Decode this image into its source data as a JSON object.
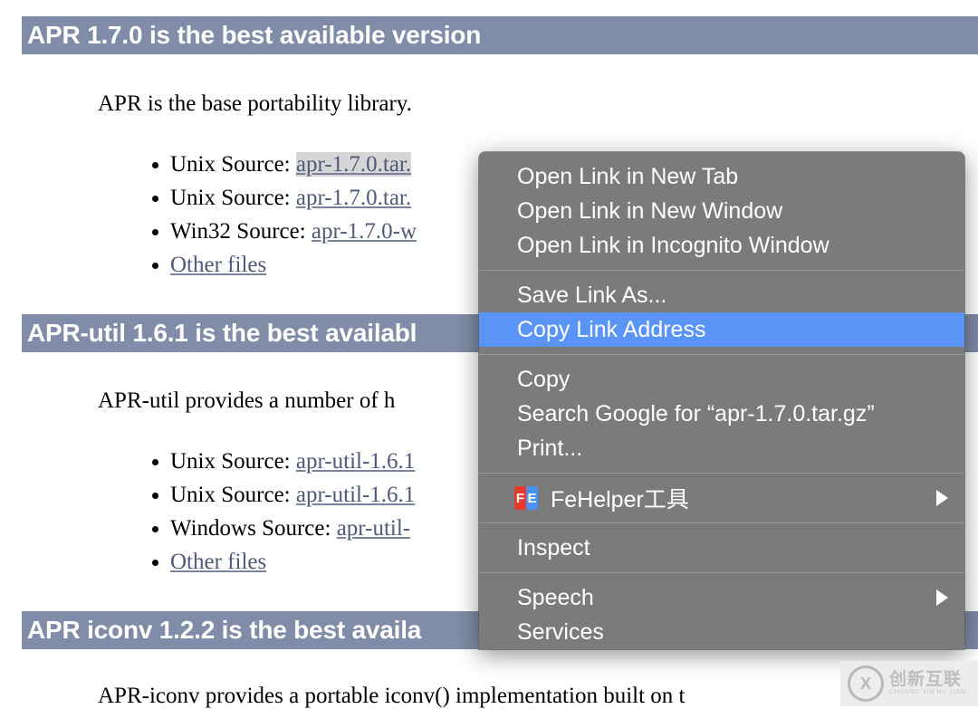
{
  "page": {
    "sections": [
      {
        "heading": "APR 1.7.0 is the best available version",
        "paragraph": "APR is the base portability library.",
        "items": [
          {
            "prefix": "Unix Source: ",
            "link": "apr-1.7.0.tar.",
            "selected": true
          },
          {
            "prefix": "Unix Source: ",
            "link": "apr-1.7.0.tar.",
            "selected": false
          },
          {
            "prefix": "Win32 Source: ",
            "link": "apr-1.7.0-w",
            "selected": false
          },
          {
            "prefix": "",
            "link": "Other files",
            "selected": false
          }
        ]
      },
      {
        "heading": "APR-util 1.6.1 is the best availabl",
        "paragraph": "APR-util provides a number of h",
        "items": [
          {
            "prefix": "Unix Source: ",
            "link": "apr-util-1.6.1",
            "selected": false
          },
          {
            "prefix": "Unix Source: ",
            "link": "apr-util-1.6.1",
            "selected": false
          },
          {
            "prefix": "Windows Source: ",
            "link": "apr-util-",
            "selected": false
          },
          {
            "prefix": "",
            "link": "Other files",
            "selected": false
          }
        ]
      },
      {
        "heading": "APR iconv 1.2.2 is the best availa",
        "paragraph": "APR-iconv provides a portable iconv() implementation built on t",
        "items": []
      }
    ],
    "colors": {
      "heading_band": "#808ca8",
      "link": "#50597a",
      "selected_link_bg": "#d6d6d6"
    }
  },
  "context_menu": {
    "groups": [
      {
        "items": [
          {
            "label": "Open Link in New Tab",
            "highlight": false,
            "arrow": false,
            "icon": ""
          },
          {
            "label": "Open Link in New Window",
            "highlight": false,
            "arrow": false,
            "icon": ""
          },
          {
            "label": "Open Link in Incognito Window",
            "highlight": false,
            "arrow": false,
            "icon": ""
          }
        ]
      },
      {
        "items": [
          {
            "label": "Save Link As...",
            "highlight": false,
            "arrow": false,
            "icon": ""
          },
          {
            "label": "Copy Link Address",
            "highlight": true,
            "arrow": false,
            "icon": ""
          }
        ]
      },
      {
        "items": [
          {
            "label": "Copy",
            "highlight": false,
            "arrow": false,
            "icon": ""
          },
          {
            "label": "Search Google for “apr-1.7.0.tar.gz”",
            "highlight": false,
            "arrow": false,
            "icon": ""
          },
          {
            "label": "Print...",
            "highlight": false,
            "arrow": false,
            "icon": ""
          }
        ]
      },
      {
        "items": [
          {
            "label": "FeHelper工具",
            "highlight": false,
            "arrow": true,
            "icon": "fehelper-icon"
          }
        ]
      },
      {
        "items": [
          {
            "label": "Inspect",
            "highlight": false,
            "arrow": false,
            "icon": ""
          }
        ]
      },
      {
        "items": [
          {
            "label": "Speech",
            "highlight": false,
            "arrow": true,
            "icon": ""
          },
          {
            "label": "Services",
            "highlight": false,
            "arrow": false,
            "icon": ""
          }
        ]
      }
    ],
    "colors": {
      "background": "#7b7b7b",
      "highlight": "#5a94f7",
      "text": "#ffffff",
      "separator": "#9a9a9a"
    },
    "fehelper_icon": {
      "left_char": "F",
      "right_char": "E",
      "left_color": "#e8392e",
      "right_color": "#4a90f0"
    }
  },
  "watermark": {
    "logo_char": "X",
    "chinese": "创新互联",
    "pinyin": "CHUANG XIN HU LIAN"
  }
}
